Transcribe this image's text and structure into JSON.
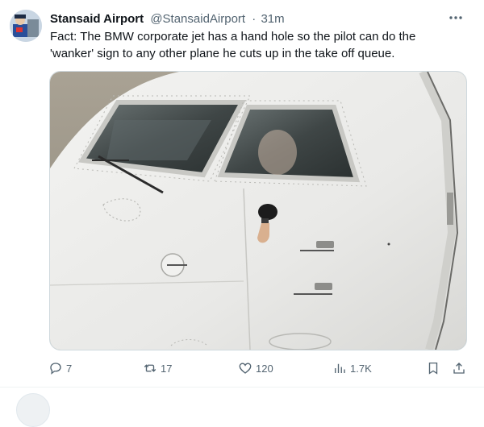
{
  "tweet": {
    "display_name": "Stansaid Airport",
    "handle": "@StansaidAirport",
    "separator": "·",
    "time": "31m",
    "text": "Fact: The BMW corporate jet has a hand hole so the pilot can do the 'wanker' sign to any other plane he cuts up in the take off queue.",
    "media_icon": "aircraft-cockpit-photo"
  },
  "actions": {
    "reply_count": "7",
    "retweet_count": "17",
    "like_count": "120",
    "views_count": "1.7K"
  },
  "icons": {
    "more": "more-horizontal-icon",
    "reply": "reply-icon",
    "retweet": "retweet-icon",
    "like": "heart-icon",
    "views": "views-icon",
    "bookmark": "bookmark-icon",
    "share": "share-icon"
  },
  "colors": {
    "text_primary": "#0f1419",
    "text_secondary": "#536471",
    "border": "#cfd9de"
  }
}
